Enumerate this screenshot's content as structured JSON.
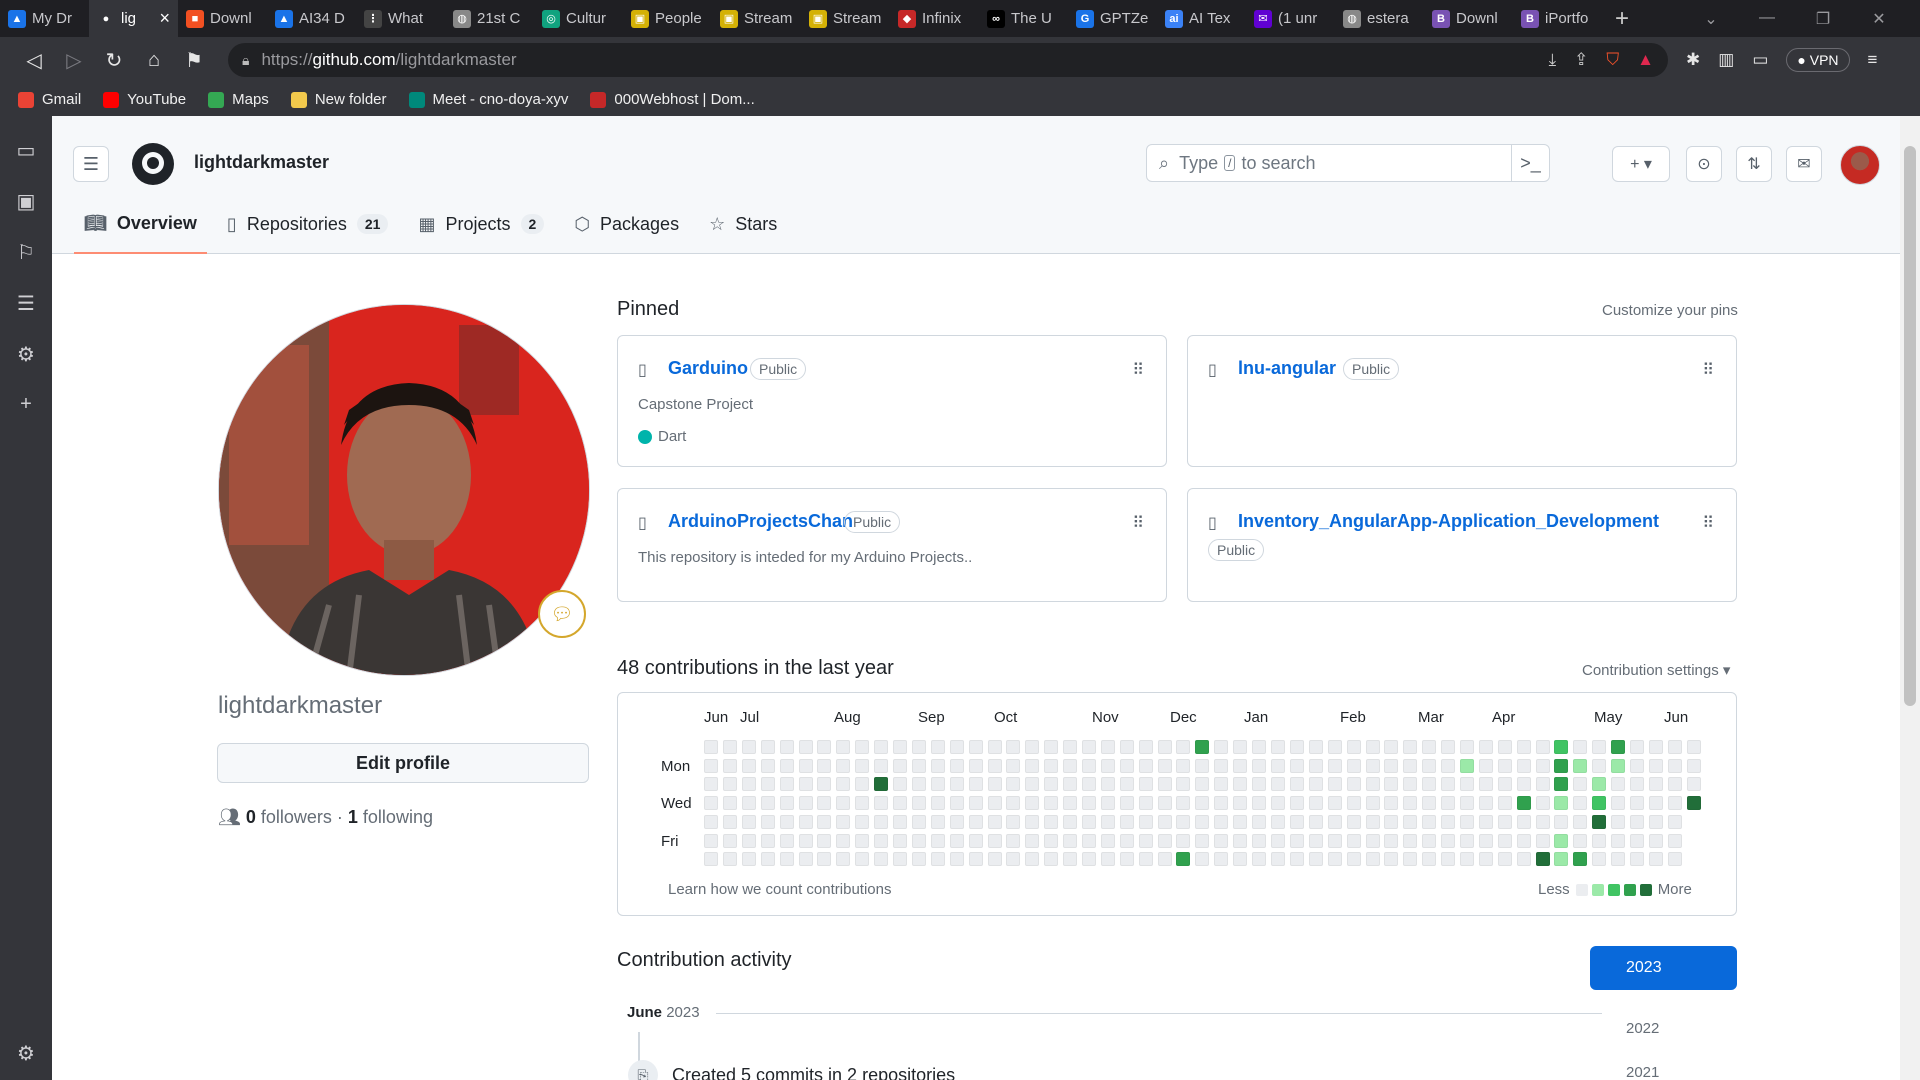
{
  "browser": {
    "tabs": [
      {
        "label": "My Dr",
        "color": "#1a73e8",
        "glyph": "▲",
        "active": false
      },
      {
        "label": "lig",
        "color": "#ffffff",
        "glyph": "●",
        "active": true
      },
      {
        "label": "Downl",
        "color": "#f25022",
        "glyph": "■",
        "active": false
      },
      {
        "label": "AI34 D",
        "color": "#1a73e8",
        "glyph": "▲",
        "active": false
      },
      {
        "label": "What",
        "color": "#444444",
        "glyph": "⋮",
        "active": false
      },
      {
        "label": "21st C",
        "color": "#888888",
        "glyph": "◍",
        "active": false
      },
      {
        "label": "Cultur",
        "color": "#10a37f",
        "glyph": "◎",
        "active": false
      },
      {
        "label": "People",
        "color": "#d4b106",
        "glyph": "▣",
        "active": false
      },
      {
        "label": "Stream",
        "color": "#d4b106",
        "glyph": "▣",
        "active": false
      },
      {
        "label": "Stream",
        "color": "#d4b106",
        "glyph": "▣",
        "active": false
      },
      {
        "label": "Infinix",
        "color": "#c62828",
        "glyph": "◆",
        "active": false
      },
      {
        "label": "The U",
        "color": "#000000",
        "glyph": "∞",
        "active": false
      },
      {
        "label": "GPTZe",
        "color": "#1a73e8",
        "glyph": "G",
        "active": false
      },
      {
        "label": "AI Tex",
        "color": "#3b82f6",
        "glyph": "ai",
        "active": false
      },
      {
        "label": "(1 unr",
        "color": "#6001d2",
        "glyph": "✉",
        "active": false
      },
      {
        "label": "estera",
        "color": "#888888",
        "glyph": "◍",
        "active": false
      },
      {
        "label": "Downl",
        "color": "#7952b3",
        "glyph": "B",
        "active": false
      },
      {
        "label": "iPortfo",
        "color": "#7952b3",
        "glyph": "B",
        "active": false
      }
    ],
    "new_tab": "+",
    "url_proto": "https://",
    "url_host": "github.com",
    "url_path": "/lightdarkmaster",
    "vpn": "VPN",
    "bookmarks": [
      {
        "label": "Gmail",
        "color": "#ea4335"
      },
      {
        "label": "YouTube",
        "color": "#ff0000"
      },
      {
        "label": "Maps",
        "color": "#34a853"
      },
      {
        "label": "New folder",
        "color": "#f2c94c"
      },
      {
        "label": "Meet - cno-doya-xyv",
        "color": "#00897b"
      },
      {
        "label": "000Webhost | Dom...",
        "color": "#c62828"
      }
    ]
  },
  "header": {
    "owner": "lightdarkmaster",
    "search_placeholder_before": "Type",
    "search_slash": "/",
    "search_placeholder_after": "to search"
  },
  "nav": {
    "tabs": [
      {
        "label": "Overview",
        "count": "",
        "icon": "book-icon"
      },
      {
        "label": "Repositories",
        "count": "21",
        "icon": "repo-icon"
      },
      {
        "label": "Projects",
        "count": "2",
        "icon": "table-icon"
      },
      {
        "label": "Packages",
        "count": "",
        "icon": "package-icon"
      },
      {
        "label": "Stars",
        "count": "",
        "icon": "star-icon"
      }
    ]
  },
  "profile": {
    "username": "lightdarkmaster",
    "edit_label": "Edit profile",
    "followers_count": "0",
    "followers_label": "followers",
    "separator": "·",
    "following_count": "1",
    "following_label": "following"
  },
  "pinned": {
    "title": "Pinned",
    "customize": "Customize your pins",
    "repos": [
      {
        "name": "Garduino",
        "visibility": "Public",
        "description": "Capstone Project",
        "language": "Dart",
        "lang_color": "#00b4ab"
      },
      {
        "name": "lnu-angular",
        "visibility": "Public",
        "description": "",
        "language": "",
        "lang_color": ""
      },
      {
        "name": "ArduinoProjectsChan",
        "visibility": "Public",
        "description": "This repository is inteded for my Arduino Projects..",
        "language": "",
        "lang_color": ""
      },
      {
        "name": "Inventory_AngularApp-Application_Development",
        "visibility": "Public",
        "description": "",
        "language": "",
        "lang_color": ""
      }
    ]
  },
  "contributions": {
    "title": "48 contributions in the last year",
    "settings": "Contribution settings ▾",
    "months": [
      "Jun",
      "Jul",
      "Aug",
      "Sep",
      "Oct",
      "Nov",
      "Dec",
      "Jan",
      "Feb",
      "Mar",
      "Apr",
      "May",
      "Jun"
    ],
    "days": [
      "Mon",
      "Wed",
      "Fri"
    ],
    "learn": "Learn how we count contributions",
    "less": "Less",
    "more": "More",
    "levels": [
      "#ebedf0",
      "#9be9a8",
      "#40c463",
      "#30a14e",
      "#216e39"
    ],
    "weeks": 53,
    "active_cells": [
      {
        "week": 26,
        "day": 0,
        "level": 3
      },
      {
        "week": 9,
        "day": 2,
        "level": 4
      },
      {
        "week": 25,
        "day": 6,
        "level": 3
      },
      {
        "week": 40,
        "day": 1,
        "level": 1
      },
      {
        "week": 43,
        "day": 3,
        "level": 3
      },
      {
        "week": 44,
        "day": 6,
        "level": 4
      },
      {
        "week": 45,
        "day": 0,
        "level": 2
      },
      {
        "week": 45,
        "day": 1,
        "level": 3
      },
      {
        "week": 45,
        "day": 2,
        "level": 3
      },
      {
        "week": 45,
        "day": 3,
        "level": 1
      },
      {
        "week": 45,
        "day": 5,
        "level": 1
      },
      {
        "week": 45,
        "day": 6,
        "level": 1
      },
      {
        "week": 46,
        "day": 1,
        "level": 1
      },
      {
        "week": 46,
        "day": 6,
        "level": 3
      },
      {
        "week": 47,
        "day": 2,
        "level": 1
      },
      {
        "week": 47,
        "day": 3,
        "level": 2
      },
      {
        "week": 47,
        "day": 4,
        "level": 4
      },
      {
        "week": 48,
        "day": 0,
        "level": 3
      },
      {
        "week": 48,
        "day": 1,
        "level": 1
      },
      {
        "week": 52,
        "day": 3,
        "level": 4
      }
    ]
  },
  "activity": {
    "title": "Contribution activity",
    "years": [
      "2023",
      "2022",
      "2021"
    ],
    "month_head": "June",
    "month_year": "2023",
    "item": "Created 5 commits in 2 repositories"
  }
}
